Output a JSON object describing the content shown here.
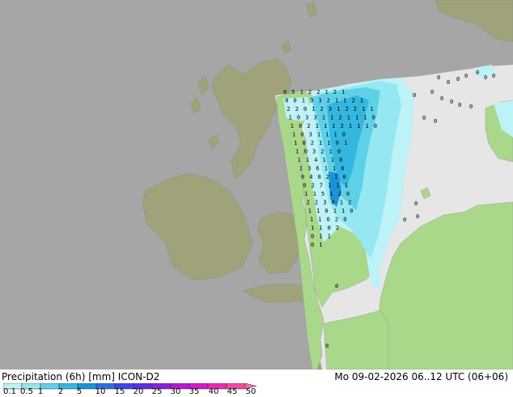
{
  "title": {
    "left": "Precipitation (6h) [mm] ICON-D2",
    "right": "Mo 09-02-2026 06..12 UTC (06+06)"
  },
  "legend": {
    "labels": [
      "0.1",
      "0.5",
      "1",
      "2",
      "5",
      "10",
      "15",
      "20",
      "25",
      "30",
      "35",
      "40",
      "45",
      "50"
    ],
    "colors": [
      "#bdf2f7",
      "#95e8f1",
      "#5ed1e9",
      "#33b7e0",
      "#1b94d6",
      "#2a6fe0",
      "#3c48e6",
      "#5b2ee3",
      "#8a22dc",
      "#b41ad2",
      "#d41ac6",
      "#e82ab2",
      "#f04aa2"
    ]
  },
  "map": {
    "sea_color": "#e6e6e6",
    "outside_domain_color": "#a6a6a6",
    "land_color": "#a9d88a",
    "land_outside_color": "#a0a37a",
    "station_values": [
      [
        "0",
        "5",
        "1",
        "2",
        "2",
        "1",
        "2",
        "1"
      ],
      [
        "0",
        "0",
        "1",
        "3",
        "3",
        "2",
        "1",
        "1",
        "2",
        "1"
      ],
      [
        "2",
        "2",
        "0",
        "1",
        "2",
        "3",
        "1",
        "2",
        "2",
        "1",
        "1"
      ],
      [
        "1",
        "0",
        "3",
        "3",
        "1",
        "1",
        "2",
        "1",
        "1",
        "1",
        "0"
      ],
      [
        "1",
        "0",
        "2",
        "1",
        "1",
        "1",
        "2",
        "1",
        "1",
        "1",
        "0"
      ],
      [
        "1",
        "0",
        "3",
        "1",
        "1",
        "1",
        "0"
      ],
      [
        "1",
        "0",
        "2",
        "1",
        "1",
        "0",
        "1"
      ],
      [
        "1",
        "0",
        "3",
        "2",
        "1",
        "0"
      ],
      [
        "1",
        "1",
        "4",
        "1",
        "1",
        "0"
      ],
      [
        "1",
        "3",
        "6",
        "1",
        "1",
        "0"
      ],
      [
        "0",
        "4",
        "8",
        "2",
        "1",
        "0"
      ],
      [
        "0",
        "2",
        "7",
        "1",
        "1",
        "1"
      ],
      [
        "1",
        "1",
        "5",
        "1",
        "2",
        "0"
      ],
      [
        "2",
        "2",
        "3",
        "0",
        "1",
        "2"
      ],
      [
        "1",
        "1",
        "0",
        "1",
        "1",
        "0"
      ],
      [
        "1",
        "1",
        "0",
        "2",
        "0"
      ],
      [
        "1",
        "1",
        "0",
        "2"
      ],
      [
        "0",
        "1",
        "1"
      ],
      [
        "0",
        "1"
      ]
    ],
    "scattered_zeros": [
      "0",
      "0",
      "0",
      "0",
      "0",
      "0",
      "0",
      "0",
      "0",
      "0",
      "0",
      "0",
      "0",
      "0",
      "0",
      "0",
      "0",
      "0",
      "0",
      "0"
    ]
  }
}
